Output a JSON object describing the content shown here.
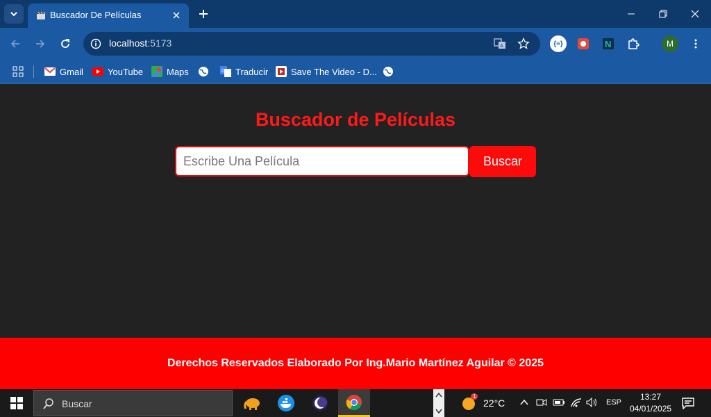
{
  "browser": {
    "tab_title": "Buscador De Películas",
    "url_host": "localhost",
    "url_port": ":5173",
    "profile_initial": "M"
  },
  "bookmarks": [
    {
      "label": "Gmail",
      "icon": "gmail-icon"
    },
    {
      "label": "YouTube",
      "icon": "youtube-icon"
    },
    {
      "label": "Maps",
      "icon": "maps-icon"
    },
    {
      "label": "",
      "icon": "globe-icon"
    },
    {
      "label": "Traducir",
      "icon": "translate-icon"
    },
    {
      "label": "Save The Video - D...",
      "icon": "savethevideo-icon"
    },
    {
      "label": "",
      "icon": "globe-icon"
    }
  ],
  "page": {
    "title": "Buscador de Películas",
    "search_placeholder": "Escribe Una Película",
    "search_button": "Buscar",
    "footer": "Derechos Reservados Elaborado Por Ing.Mario Martínez Aguilar © 2025"
  },
  "taskbar": {
    "search_label": "Buscar",
    "weather": "22°C",
    "weather_badge": "1",
    "language": "ESP",
    "time": "13:27",
    "date": "04/01/2025"
  },
  "colors": {
    "accent_red": "#ff0000",
    "page_bg": "#222222",
    "browser_blue": "#1b5aa3"
  }
}
